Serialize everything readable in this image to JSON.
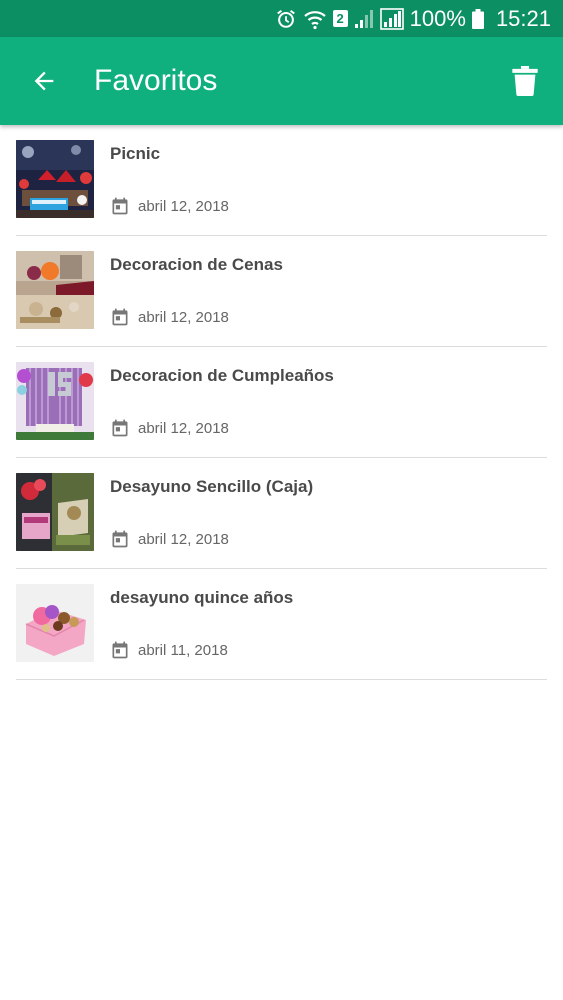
{
  "status_bar": {
    "sim_slot": "2",
    "battery": "100%",
    "time": "15:21"
  },
  "app_bar": {
    "title": "Favoritos"
  },
  "favorites": [
    {
      "title": "Picnic",
      "date": "abril 12, 2018",
      "thumb": "picnic-photo"
    },
    {
      "title": "Decoracion de Cenas",
      "date": "abril 12, 2018",
      "thumb": "dinner-decoration-photo"
    },
    {
      "title": "Decoracion de Cumpleaños",
      "date": "abril 12, 2018",
      "thumb": "birthday-decoration-photo"
    },
    {
      "title": "Desayuno Sencillo (Caja)",
      "date": "abril 12, 2018",
      "thumb": "breakfast-box-photo"
    },
    {
      "title": "desayuno quince años",
      "date": "abril 11, 2018",
      "thumb": "quinceanera-breakfast-photo"
    }
  ],
  "colors": {
    "status_bar": "#0d8f64",
    "app_bar": "#0fb07d",
    "title_text": "#ffffff",
    "item_title": "#4a4a4a",
    "item_date": "#666666",
    "divider": "#dcdcdc"
  }
}
